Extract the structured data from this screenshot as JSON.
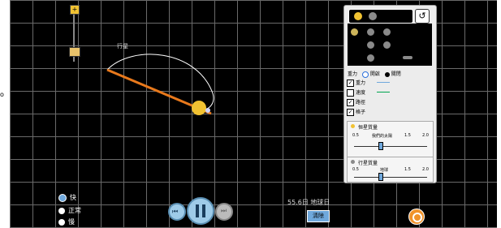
{
  "zoom": {
    "plus": "+",
    "minus": "-"
  },
  "path_label": "行星",
  "edge_mark": "o",
  "body_selector": {
    "selected": "sun-planet",
    "reset_icon": "↺"
  },
  "gravity_row": {
    "label": "重力",
    "opt1": "開啟",
    "opt2": "關閉",
    "selected": "開啟"
  },
  "checkboxes": [
    {
      "label": "重力",
      "checked": true,
      "color": "#6fa8dc"
    },
    {
      "label": "速度",
      "checked": false,
      "color": "#00a651"
    },
    {
      "label": "路徑",
      "checked": true,
      "color": "#000000"
    },
    {
      "label": "格子",
      "checked": true,
      "color": "#000000"
    }
  ],
  "star_mass": {
    "title": "恒星質量",
    "ticks": [
      "0.5",
      "我們的太陽",
      "1.5",
      "2.0"
    ],
    "value_fraction": 0.33
  },
  "planet_mass": {
    "title": "行星質量",
    "ticks": [
      "0.5",
      "地球",
      "1.5",
      "2.0"
    ],
    "value_fraction": 0.33
  },
  "speed": {
    "options": [
      "快",
      "正常",
      "慢"
    ],
    "selected": "快"
  },
  "days": "55.6日 地球日",
  "clear": "清除",
  "colors": {
    "accent": "#f0932b",
    "sun": "#f1c232"
  }
}
